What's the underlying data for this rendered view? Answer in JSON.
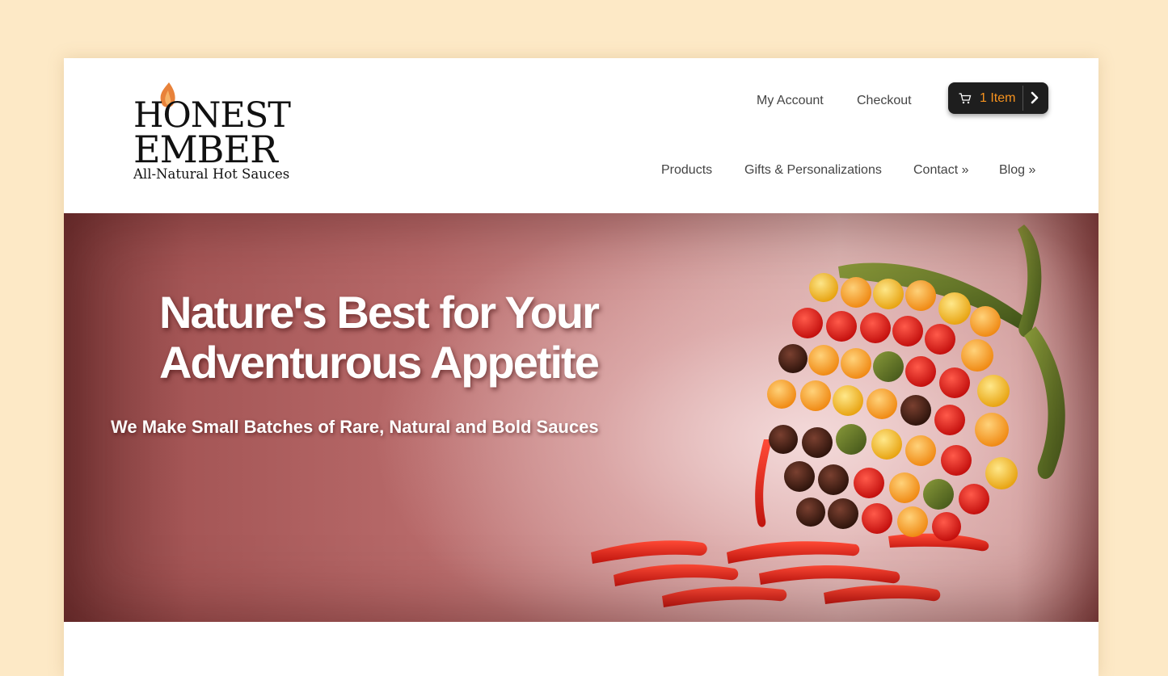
{
  "brand": {
    "name_line1": "HONEST",
    "name_line2": "EMBER",
    "tagline": "All-Natural Hot Sauces"
  },
  "top_links": [
    {
      "label": "My Account"
    },
    {
      "label": "Checkout"
    }
  ],
  "cart": {
    "label": "1 Item",
    "icon": "cart-icon",
    "arrow_icon": "chevron-right-icon"
  },
  "main_nav": [
    {
      "label": "Products"
    },
    {
      "label": "Gifts & Personalizations"
    },
    {
      "label": "Contact »"
    },
    {
      "label": "Blog »"
    }
  ],
  "hero": {
    "title": "Nature's Best for Your Adventurous Appetite",
    "subtitle": "We Make Small Batches of Rare, Natural and Bold Sauces"
  },
  "colors": {
    "page_background": "#fde9c6",
    "accent": "#f7931e",
    "cart_background": "#1e1e1e",
    "nav_text": "#444444"
  }
}
